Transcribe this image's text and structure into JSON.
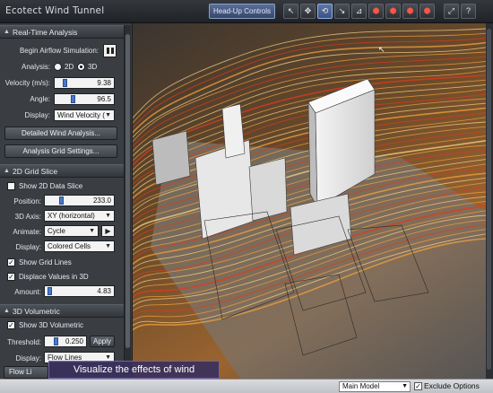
{
  "app": {
    "title": "Ecotect Wind Tunnel"
  },
  "toolbar": {
    "hud_label": "Head-Up Controls",
    "tools": [
      {
        "icon": "pointer-icon",
        "glyph": "↖"
      },
      {
        "icon": "pan-icon",
        "glyph": "✥"
      },
      {
        "icon": "orbit-icon",
        "glyph": "⟲"
      },
      {
        "icon": "probe-icon",
        "glyph": "↘"
      },
      {
        "icon": "slice-icon",
        "glyph": "⊿"
      },
      {
        "icon": "box-red-icon",
        "glyph": "⬢"
      },
      {
        "icon": "box-red-2-icon",
        "glyph": "⬢"
      },
      {
        "icon": "box-red-3-icon",
        "glyph": "⬢"
      },
      {
        "icon": "box-red-4-icon",
        "glyph": "⬢"
      },
      {
        "icon": "fit-view-icon",
        "glyph": "⤢"
      },
      {
        "icon": "help-icon",
        "glyph": "?"
      }
    ]
  },
  "realtime": {
    "header": "Real-Time Analysis",
    "begin_label": "Begin Airflow Simulation:",
    "analysis_label": "Analysis:",
    "opt_2d": "2D",
    "opt_3d": "3D",
    "analysis_value": "3D",
    "velocity_label": "Velocity (m/s):",
    "velocity_value": "9.38",
    "velocity_level": 0.12,
    "angle_label": "Angle:",
    "angle_value": "96.5",
    "angle_level": 0.27,
    "display_label": "Display:",
    "display_value": "Wind Velocity (",
    "detailed_btn": "Detailed Wind Analysis...",
    "grid_btn": "Analysis Grid Settings..."
  },
  "slice": {
    "header": "2D Grid Slice",
    "show_label": "Show 2D Data Slice",
    "show_checked": false,
    "position_label": "Position:",
    "position_value": "233.0",
    "position_level": 0.2,
    "axis_label": "3D Axis:",
    "axis_value": "XY (horizontal)",
    "animate_label": "Animate:",
    "animate_value": "Cycle",
    "display_label": "Display:",
    "display_value": "Colored Cells",
    "grid_lines_label": "Show Grid Lines",
    "grid_lines_checked": true,
    "displace_label": "Displace Values in 3D",
    "displace_checked": true,
    "amount_label": "Amount:",
    "amount_value": "4.83",
    "amount_level": 0.02
  },
  "volumetric": {
    "header": "3D Volumetric",
    "show_label": "Show 3D Volumetric",
    "show_checked": true,
    "threshold_label": "Threshold:",
    "threshold_value": "0.250",
    "threshold_level": 0.2,
    "apply_btn": "Apply",
    "display_label": "Display:",
    "display_value": "Flow Lines",
    "flow_btn": "Flow Li"
  },
  "caption": "Visualize the effects of wind",
  "status": {
    "model_value": "Main Model",
    "exclude_label": "Exclude Options",
    "exclude_checked": true
  },
  "colors": {
    "accent": "#4b78c8",
    "flow_hot": "#e23a1e",
    "flow_warm": "#f2a23c",
    "flow_cool": "#f6d68a",
    "caption_bg": "#3a305c"
  }
}
